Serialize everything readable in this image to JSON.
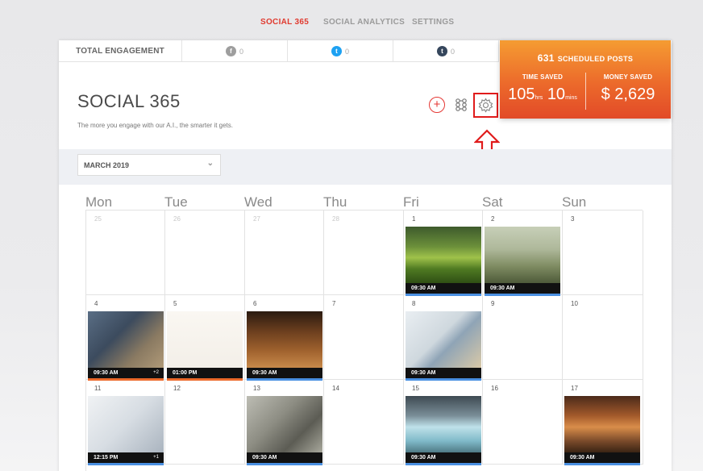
{
  "nav": {
    "items": [
      {
        "label": "SOCIAL 365",
        "active": true
      },
      {
        "label": "SOCIAL ANALYTICS",
        "active": false
      },
      {
        "label": "SETTINGS",
        "active": false
      }
    ]
  },
  "engagement": {
    "label": "TOTAL ENGAGEMENT",
    "networks": [
      {
        "icon": "facebook-icon",
        "glyph": "f",
        "color": "#9e9e9e",
        "count": "0"
      },
      {
        "icon": "twitter-icon",
        "glyph": "t",
        "color": "#1da1f2",
        "count": "0"
      },
      {
        "icon": "tumblr-icon",
        "glyph": "t",
        "color": "#35465c",
        "count": "0"
      }
    ]
  },
  "scheduled": {
    "count": "631",
    "label": "SCHEDULED POSTS",
    "time_saved_label": "TIME SAVED",
    "hours": "105",
    "hours_unit": "hrs",
    "minutes": "10",
    "minutes_unit": "mins",
    "money_saved_label": "MONEY SAVED",
    "money": "$ 2,629"
  },
  "page": {
    "title": "SOCIAL 365",
    "subtitle": "The more you engage with our A.I., the smarter it gets."
  },
  "month_select": {
    "value": "MARCH 2019"
  },
  "weekdays": [
    "Mon",
    "Tue",
    "Wed",
    "Thu",
    "Fri",
    "Sat",
    "Sun"
  ],
  "weeks": [
    [
      {
        "day": "25",
        "dim": true
      },
      {
        "day": "26",
        "dim": true
      },
      {
        "day": "27",
        "dim": true
      },
      {
        "day": "28",
        "dim": true
      },
      {
        "day": "1",
        "post": {
          "time": "09:30 AM",
          "image": "forest",
          "accent": "#4a90e2"
        }
      },
      {
        "day": "2",
        "post": {
          "time": "09:30 AM",
          "image": "grass",
          "accent": "#4a90e2"
        }
      },
      {
        "day": "3"
      }
    ],
    [
      {
        "day": "4",
        "post": {
          "time": "09:30 AM",
          "extra": "+2",
          "image": "person",
          "accent": "#ec6a2b"
        }
      },
      {
        "day": "5",
        "post": {
          "time": "01:00 PM",
          "image": "sketch",
          "accent": "#ec6a2b"
        }
      },
      {
        "day": "6",
        "post": {
          "time": "09:30 AM",
          "image": "coffee",
          "accent": "#4a90e2"
        }
      },
      {
        "day": "7"
      },
      {
        "day": "8",
        "post": {
          "time": "09:30 AM",
          "image": "books",
          "accent": "#4a90e2"
        }
      },
      {
        "day": "9"
      },
      {
        "day": "10"
      }
    ],
    [
      {
        "day": "11",
        "post": {
          "time": "12:15 PM",
          "extra": "+1",
          "image": "glasses",
          "accent": "#4a90e2"
        }
      },
      {
        "day": "12"
      },
      {
        "day": "13",
        "post": {
          "time": "09:30 AM",
          "image": "banknote",
          "accent": "#4a90e2"
        }
      },
      {
        "day": "14"
      },
      {
        "day": "15",
        "post": {
          "time": "09:30 AM",
          "image": "lagoon",
          "accent": "#4a90e2"
        }
      },
      {
        "day": "16"
      },
      {
        "day": "17",
        "post": {
          "time": "09:30 AM",
          "image": "arcade",
          "accent": "#4a90e2"
        }
      }
    ]
  ]
}
